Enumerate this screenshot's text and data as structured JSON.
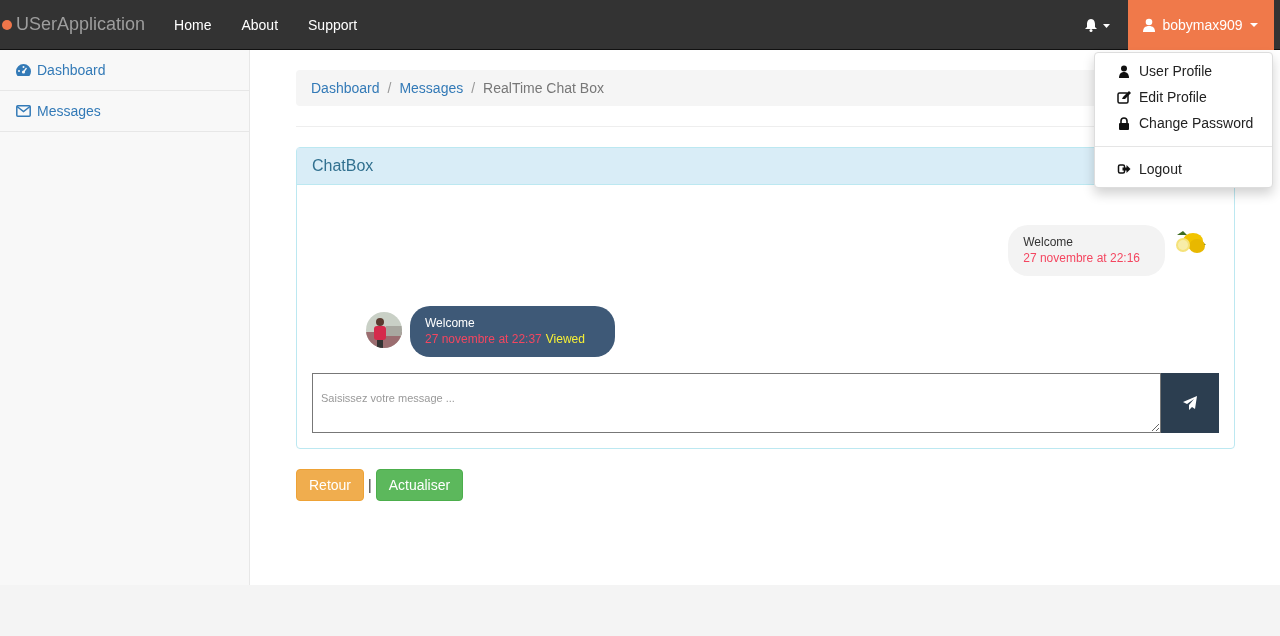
{
  "navbar": {
    "brand": "USerApplication",
    "links": [
      {
        "label": "Home"
      },
      {
        "label": "About"
      },
      {
        "label": "Support"
      }
    ],
    "user": {
      "name": "bobymax909",
      "expanded": true
    },
    "user_menu": [
      {
        "label": "User Profile",
        "kind": "user"
      },
      {
        "label": "Edit Profile",
        "kind": "edit"
      },
      {
        "label": "Change Password",
        "kind": "lock"
      },
      {
        "label": "Logout",
        "kind": "logout"
      }
    ]
  },
  "sidebar": {
    "items": [
      {
        "label": "Dashboard",
        "kind": "dashboard"
      },
      {
        "label": "Messages",
        "kind": "envelope"
      }
    ]
  },
  "breadcrumb": {
    "separators": [
      "/",
      "/"
    ],
    "items": [
      {
        "label": "Dashboard",
        "link": true
      },
      {
        "label": "Messages",
        "link": true
      },
      {
        "label": "RealTime Chat Box",
        "link": false
      }
    ]
  },
  "chatbox": {
    "title": "ChatBox",
    "messages": [
      {
        "kind": "sent",
        "text": "Welcome",
        "time": "27 novembre at 22:16"
      },
      {
        "kind": "received",
        "text": "Welcome",
        "time": "27 novembre at 22:37",
        "status": "Viewed"
      }
    ],
    "input": {
      "placeholder": "Saisissez votre message ..."
    }
  },
  "buttons": [
    {
      "label": "Retour",
      "kind": "warning"
    },
    {
      "label": "Actualiser",
      "kind": "success"
    }
  ],
  "separator": "|"
}
